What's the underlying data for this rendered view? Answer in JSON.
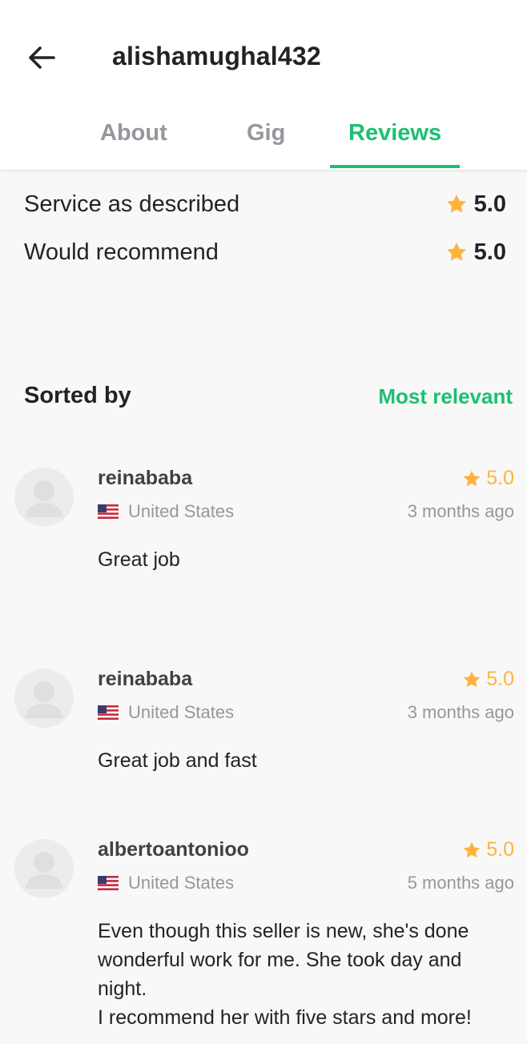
{
  "header": {
    "title": "alishamughal432",
    "back_icon": "arrow-left-icon"
  },
  "tabs": [
    {
      "label": "About",
      "active": false
    },
    {
      "label": "Gig",
      "active": false
    },
    {
      "label": "Reviews",
      "active": true
    }
  ],
  "ratings": [
    {
      "label": "Service as described",
      "value": "5.0"
    },
    {
      "label": "Would recommend",
      "value": "5.0"
    }
  ],
  "sort": {
    "label": "Sorted by",
    "value": "Most relevant"
  },
  "reviews": [
    {
      "user": "reinababa",
      "rating": "5.0",
      "country": "United States",
      "time": "3 months ago",
      "text": "Great job"
    },
    {
      "user": "reinababa",
      "rating": "5.0",
      "country": "United States",
      "time": "3 months ago",
      "text": "Great job and fast"
    },
    {
      "user": "albertoantonioo",
      "rating": "5.0",
      "country": "United States",
      "time": "5 months ago",
      "text": "Even though this seller is new, she's done\nwonderful work for me. She took day and\nnight.\nI recommend her with five stars and more!"
    }
  ],
  "colors": {
    "accent": "#1dbf73",
    "star": "#ffb33e",
    "muted": "#95979d"
  }
}
